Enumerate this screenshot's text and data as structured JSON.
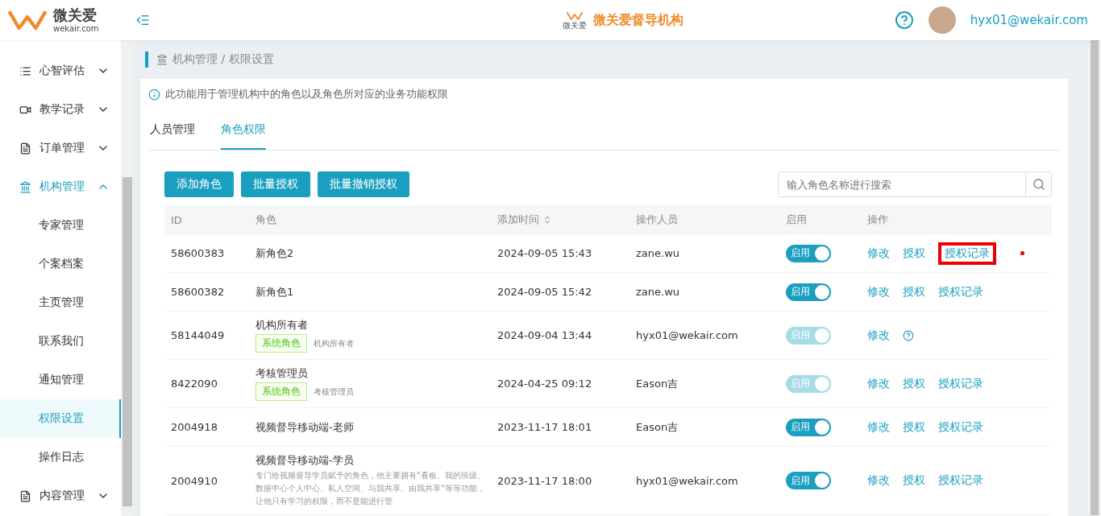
{
  "header": {
    "logo_name": "微关爱",
    "logo_domain": "wekair.com",
    "title_logo_text": "微关爱",
    "title": "微关爱督导机构",
    "user": "hyx01@wekair.com"
  },
  "sidebar": {
    "items": [
      {
        "label": "心智评估",
        "expanded": false,
        "selected": false
      },
      {
        "label": "教学记录",
        "expanded": false,
        "selected": false
      },
      {
        "label": "订单管理",
        "expanded": false,
        "selected": false
      },
      {
        "label": "机构管理",
        "expanded": true,
        "selected": true,
        "children": [
          {
            "label": "专家管理",
            "selected": false
          },
          {
            "label": "个案档案",
            "selected": false
          },
          {
            "label": "主页管理",
            "selected": false
          },
          {
            "label": "联系我们",
            "selected": false
          },
          {
            "label": "通知管理",
            "selected": false
          },
          {
            "label": "权限设置",
            "selected": true
          },
          {
            "label": "操作日志",
            "selected": false
          }
        ]
      },
      {
        "label": "内容管理",
        "expanded": false,
        "selected": false
      }
    ]
  },
  "breadcrumb": "机构管理 / 权限设置",
  "notice": "此功能用于管理机构中的角色以及角色所对应的业务功能权限",
  "tabs": [
    {
      "label": "人员管理",
      "selected": false
    },
    {
      "label": "角色权限",
      "selected": true
    }
  ],
  "buttons": [
    "添加角色",
    "批量授权",
    "批量撤销授权"
  ],
  "search": {
    "placeholder": "输入角色名称进行搜索"
  },
  "table": {
    "columns": [
      "ID",
      "角色",
      "添加时间",
      "操作人员",
      "启用",
      "操作"
    ],
    "rows": [
      {
        "id": "58600383",
        "role": "新角色2",
        "time": "2024-09-05 15:43",
        "operator": "zane.wu",
        "switch_label": "启用",
        "on": true,
        "disabled": false,
        "actions": [
          "修改",
          "授权",
          "授权记录"
        ],
        "help": false,
        "highlighted": true
      },
      {
        "id": "58600382",
        "role": "新角色1",
        "time": "2024-09-05 15:42",
        "operator": "zane.wu",
        "switch_label": "启用",
        "on": true,
        "disabled": false,
        "actions": [
          "修改",
          "授权",
          "授权记录"
        ],
        "help": false,
        "highlighted": false
      },
      {
        "id": "58144049",
        "role": "机构所有者",
        "tag": "系统角色",
        "tag_note": "机构所有者",
        "time": "2024-09-04 13:44",
        "operator": "hyx01@wekair.com",
        "switch_label": "启用",
        "on": true,
        "disabled": true,
        "actions": [
          "修改"
        ],
        "help": true,
        "highlighted": false
      },
      {
        "id": "8422090",
        "role": "考核管理员",
        "tag": "系统角色",
        "tag_note": "考核管理员",
        "time": "2024-04-25 09:12",
        "operator": "Eason吉",
        "switch_label": "启用",
        "on": true,
        "disabled": true,
        "actions": [
          "修改",
          "授权",
          "授权记录"
        ],
        "help": false,
        "highlighted": false
      },
      {
        "id": "2004918",
        "role": "视频督导移动端-老师",
        "time": "2023-11-17 18:01",
        "operator": "Eason吉",
        "switch_label": "启用",
        "on": true,
        "disabled": false,
        "actions": [
          "修改",
          "授权",
          "授权记录"
        ],
        "help": false,
        "highlighted": false
      },
      {
        "id": "2004910",
        "role": "视频督导移动端-学员",
        "description": "专门给视频督导学员赋予的角色，他主要拥有\"看板、我的班级、数据中心个人中心、私人空间、与我共享、由我共享\"等等功能，让他只有学习的权限，而不是能进行管",
        "time": "2023-11-17 18:00",
        "operator": "hyx01@wekair.com",
        "switch_label": "启用",
        "on": true,
        "disabled": false,
        "actions": [
          "修改",
          "授权",
          "授权记录"
        ],
        "help": false,
        "highlighted": false
      }
    ]
  }
}
